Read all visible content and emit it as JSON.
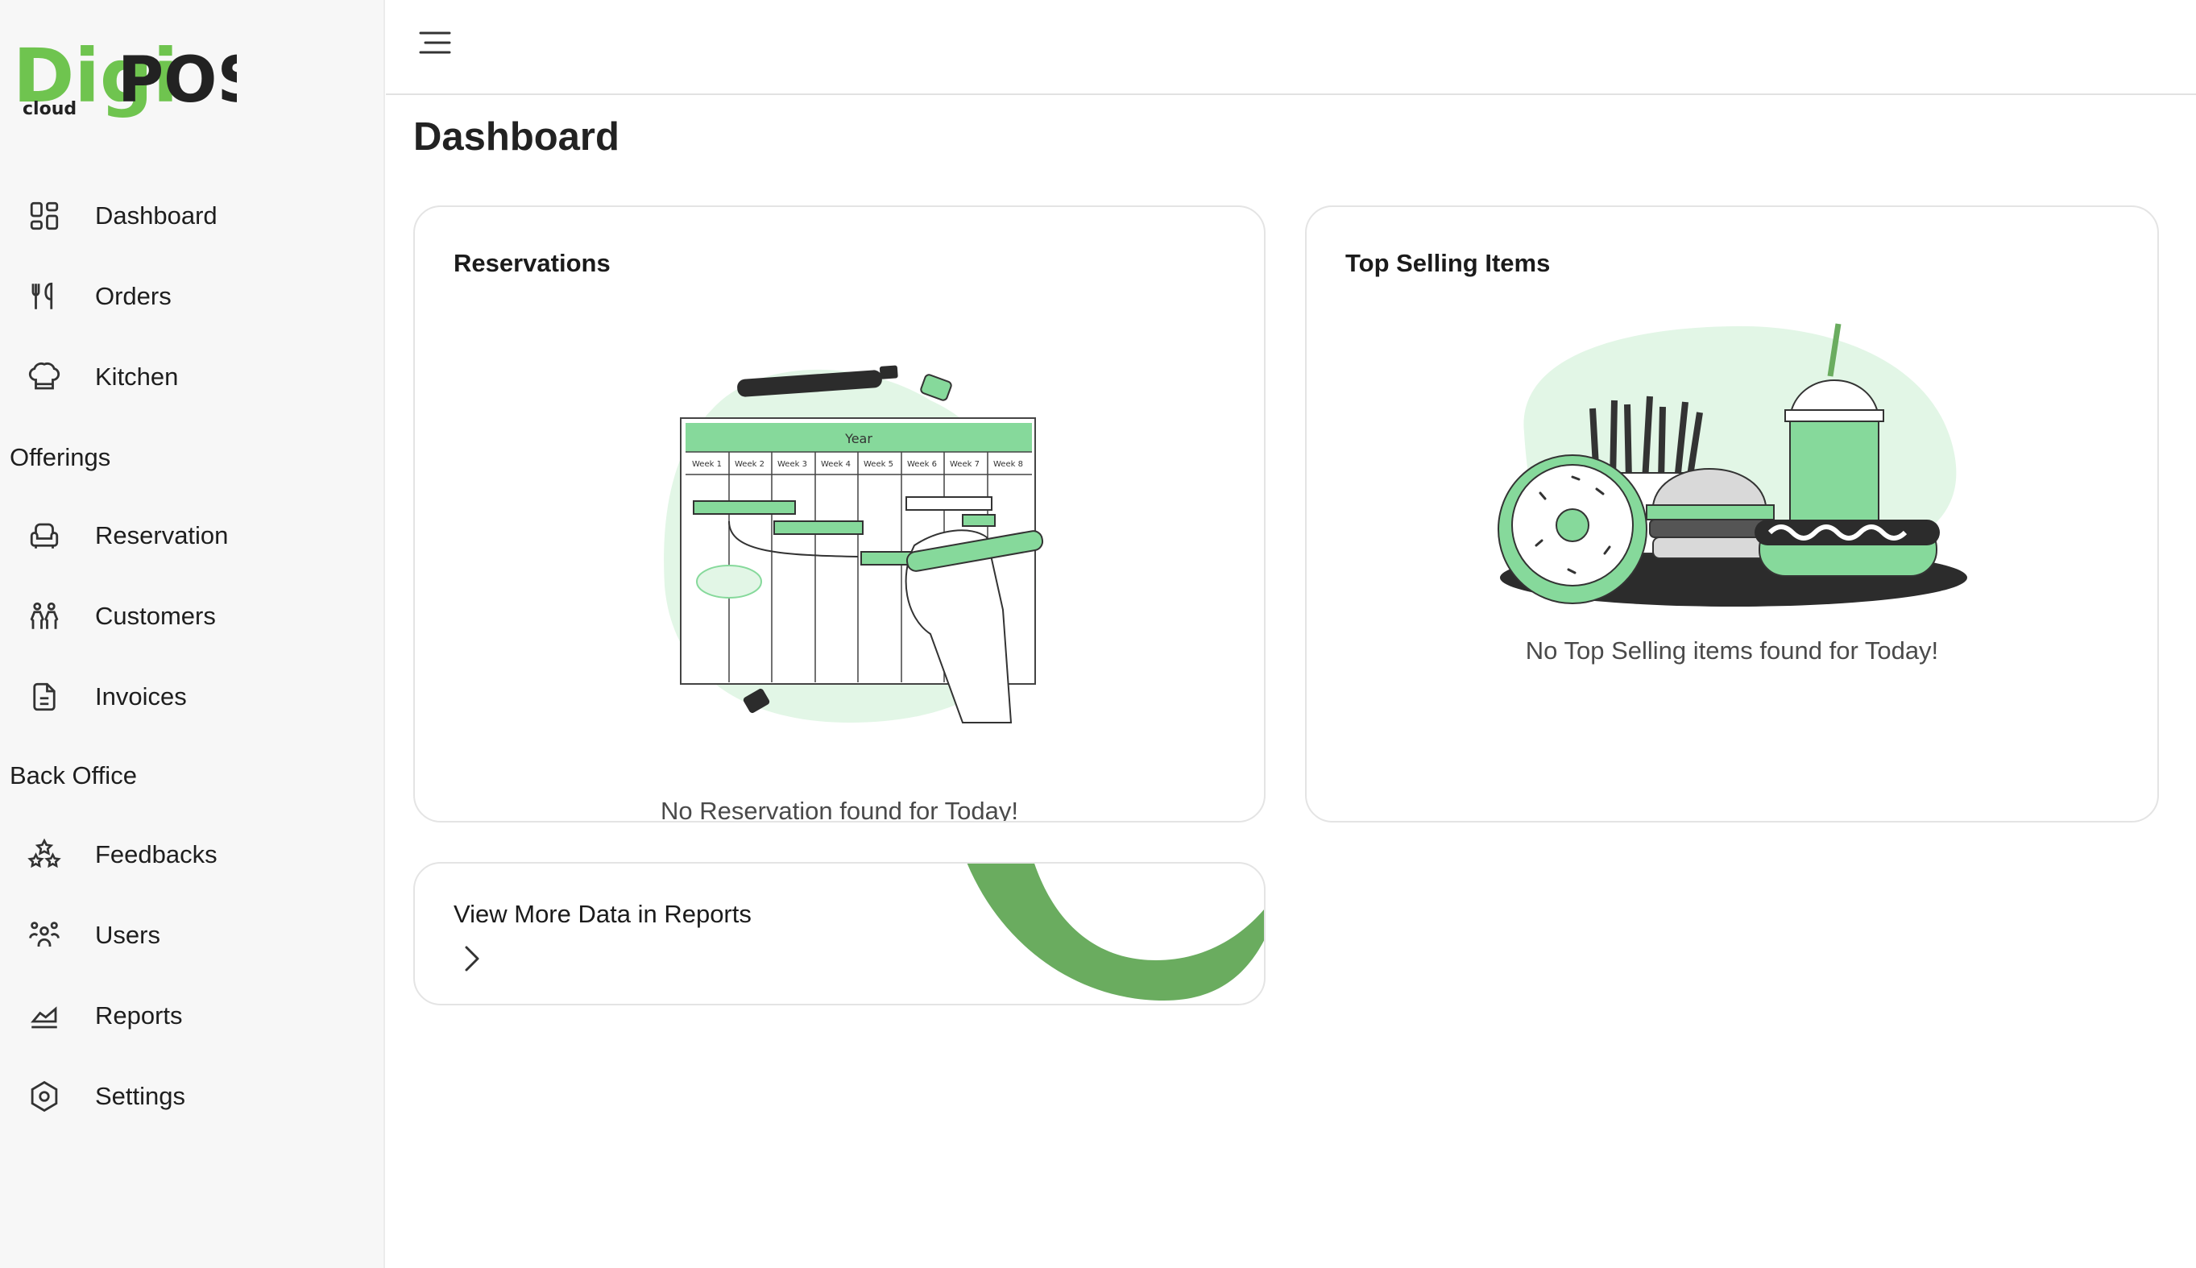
{
  "brand": {
    "logo_main_a": "Digi",
    "logo_main_b": "POS",
    "logo_sub": "cloud",
    "accent": "#6aac5f",
    "light_green": "#e2f6e6",
    "mid_green": "#86d99b"
  },
  "sidebar": {
    "items_top": [
      {
        "label": "Dashboard",
        "icon": "dashboard-grid-icon"
      },
      {
        "label": "Orders",
        "icon": "fork-knife-icon"
      },
      {
        "label": "Kitchen",
        "icon": "chef-hat-icon"
      }
    ],
    "section_offerings": "Offerings",
    "items_offerings": [
      {
        "label": "Reservation",
        "icon": "armchair-icon"
      },
      {
        "label": "Customers",
        "icon": "people-icon"
      },
      {
        "label": "Invoices",
        "icon": "document-icon"
      }
    ],
    "section_backoffice": "Back Office",
    "items_backoffice": [
      {
        "label": "Feedbacks",
        "icon": "stars-icon"
      },
      {
        "label": "Users",
        "icon": "users-group-icon"
      },
      {
        "label": "Reports",
        "icon": "chart-area-icon"
      },
      {
        "label": "Settings",
        "icon": "settings-hexagon-icon"
      }
    ]
  },
  "header": {
    "menu_icon": "hamburger-icon"
  },
  "main": {
    "title": "Dashboard",
    "reservations": {
      "title": "Reservations",
      "empty_message": "No Reservation found for Today!",
      "calendar_header": "Year",
      "weeks": [
        "Week 1",
        "Week 2",
        "Week 3",
        "Week 4",
        "Week 5",
        "Week 6",
        "Week 7",
        "Week 8"
      ]
    },
    "top_selling": {
      "title": "Top Selling Items",
      "empty_message": "No Top Selling items found for Today!"
    },
    "reports_link": {
      "label": "View More Data in Reports",
      "icon": "chevron-right-icon"
    }
  }
}
